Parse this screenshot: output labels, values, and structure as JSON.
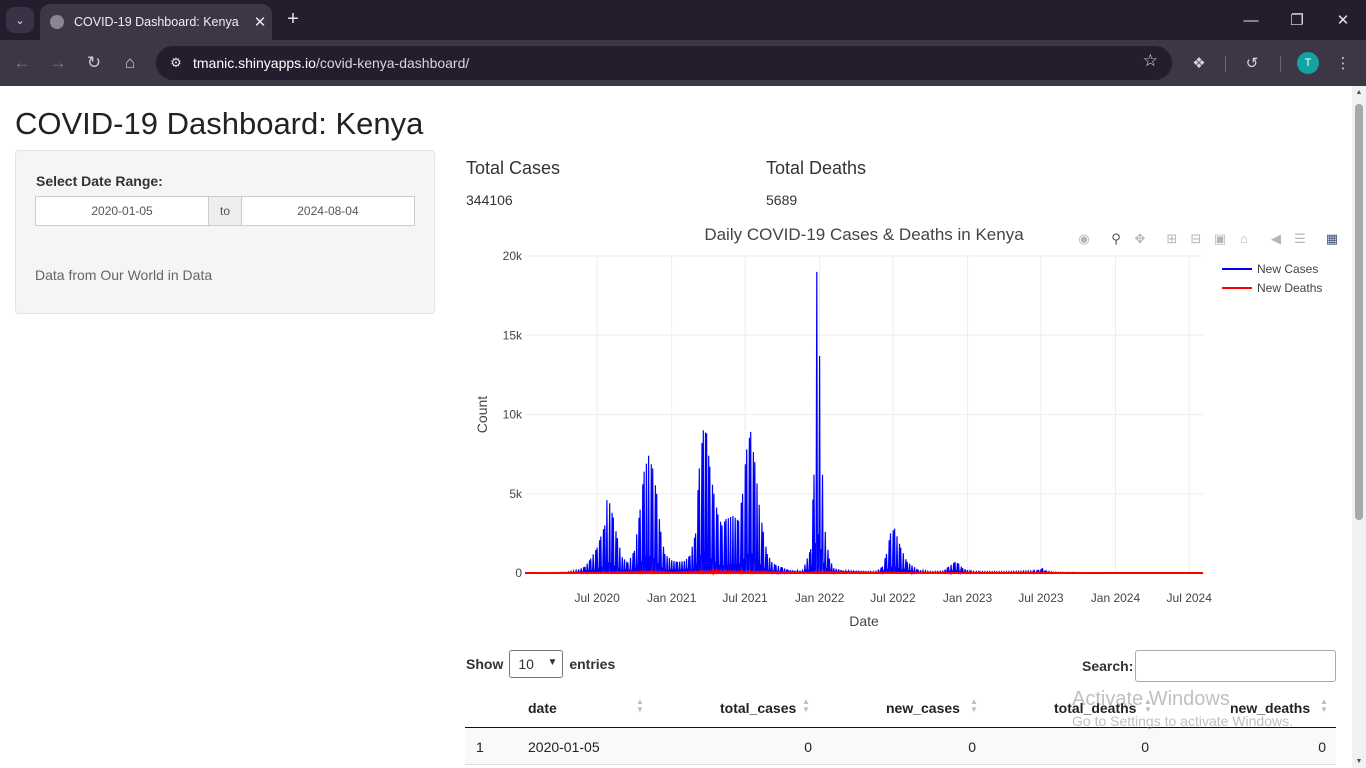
{
  "browser": {
    "tab_title": "COVID-19 Dashboard: Kenya",
    "url_host": "tmanic.shinyapps.io",
    "url_path": "/covid-kenya-dashboard/",
    "profile_initial": "T"
  },
  "page": {
    "title": "COVID-19 Dashboard: Kenya"
  },
  "sidebar": {
    "date_label": "Select Date Range:",
    "start_date": "2020-01-05",
    "range_sep": "to",
    "end_date": "2024-08-04",
    "source_text": "Data from Our World in Data"
  },
  "stats": {
    "cases_label": "Total Cases",
    "cases_value": "344106",
    "deaths_label": "Total Deaths",
    "deaths_value": "5689"
  },
  "chart_data": {
    "type": "line",
    "title": "Daily COVID-19 Cases & Deaths in Kenya",
    "xlabel": "Date",
    "ylabel": "Count",
    "ylim": [
      0,
      20000
    ],
    "yticks": [
      0,
      5000,
      10000,
      15000,
      20000
    ],
    "ytick_labels": [
      "0",
      "5k",
      "10k",
      "15k",
      "20k"
    ],
    "xticks": [
      "2020-07-01",
      "2021-01-01",
      "2021-07-01",
      "2022-01-01",
      "2022-07-01",
      "2023-01-01",
      "2023-07-01",
      "2024-01-01",
      "2024-07-01"
    ],
    "xtick_labels": [
      "Jul 2020",
      "Jan 2021",
      "Jul 2021",
      "Jan 2022",
      "Jul 2022",
      "Jan 2023",
      "Jul 2023",
      "Jan 2024",
      "Jul 2024"
    ],
    "xlim": [
      "2020-01-05",
      "2024-08-04"
    ],
    "legend_position": "top-right",
    "grid": true,
    "series": [
      {
        "name": "New Cases",
        "color": "#0000ff",
        "x": [
          "2020-01-05",
          "2020-03-15",
          "2020-04-15",
          "2020-05-10",
          "2020-06-01",
          "2020-06-15",
          "2020-07-01",
          "2020-07-10",
          "2020-07-20",
          "2020-07-25",
          "2020-08-01",
          "2020-08-10",
          "2020-08-20",
          "2020-09-01",
          "2020-09-15",
          "2020-10-01",
          "2020-10-15",
          "2020-10-25",
          "2020-11-05",
          "2020-11-15",
          "2020-11-25",
          "2020-12-05",
          "2020-12-15",
          "2021-01-01",
          "2021-01-15",
          "2021-02-01",
          "2021-02-15",
          "2021-03-01",
          "2021-03-10",
          "2021-03-20",
          "2021-03-28",
          "2021-04-05",
          "2021-04-15",
          "2021-04-25",
          "2021-05-05",
          "2021-05-15",
          "2021-06-01",
          "2021-06-15",
          "2021-06-25",
          "2021-07-05",
          "2021-07-15",
          "2021-07-25",
          "2021-08-05",
          "2021-08-15",
          "2021-08-25",
          "2021-09-05",
          "2021-09-15",
          "2021-10-01",
          "2021-10-15",
          "2021-11-01",
          "2021-11-20",
          "2021-12-10",
          "2021-12-18",
          "2021-12-25",
          "2022-01-01",
          "2022-01-08",
          "2022-01-15",
          "2022-01-25",
          "2022-02-05",
          "2022-03-01",
          "2022-04-01",
          "2022-05-01",
          "2022-05-20",
          "2022-06-05",
          "2022-06-15",
          "2022-06-25",
          "2022-07-05",
          "2022-07-20",
          "2022-08-05",
          "2022-09-01",
          "2022-10-01",
          "2022-11-01",
          "2022-11-15",
          "2022-12-01",
          "2022-12-10",
          "2022-12-20",
          "2023-01-10",
          "2023-02-01",
          "2023-04-01",
          "2023-06-15",
          "2023-06-25",
          "2023-07-05",
          "2023-07-15",
          "2023-08-01",
          "2023-10-01",
          "2024-01-01",
          "2024-04-01",
          "2024-08-04"
        ],
        "y": [
          0,
          20,
          50,
          150,
          400,
          900,
          1600,
          2300,
          3000,
          4600,
          4400,
          3500,
          2200,
          1000,
          650,
          1400,
          4000,
          6400,
          7400,
          6600,
          5000,
          2600,
          1200,
          800,
          700,
          750,
          1100,
          2500,
          6600,
          9000,
          8800,
          6700,
          5000,
          3700,
          3000,
          3400,
          3600,
          3300,
          5000,
          7800,
          8900,
          7000,
          4300,
          2600,
          1200,
          700,
          500,
          350,
          200,
          150,
          150,
          1500,
          6200,
          19000,
          13700,
          6200,
          2600,
          900,
          300,
          150,
          100,
          80,
          100,
          400,
          1200,
          2500,
          2800,
          1600,
          700,
          200,
          80,
          100,
          400,
          700,
          600,
          300,
          100,
          80,
          80,
          120,
          200,
          300,
          100,
          50,
          30,
          20,
          20,
          20
        ]
      },
      {
        "name": "New Deaths",
        "color": "#ff0000",
        "x": [
          "2020-01-05",
          "2020-07-01",
          "2020-11-15",
          "2021-01-01",
          "2021-04-15",
          "2021-08-01",
          "2021-12-01",
          "2022-01-10",
          "2022-07-01",
          "2023-01-01",
          "2024-08-04"
        ],
        "y": [
          0,
          20,
          80,
          30,
          100,
          70,
          20,
          60,
          20,
          5,
          0
        ]
      }
    ]
  },
  "modebar": {
    "icons": [
      "camera-icon",
      "zoom-icon",
      "pan-icon",
      "zoom-in-icon",
      "zoom-out-icon",
      "autoscale-icon",
      "reset-axes-icon",
      "hover-closest-icon",
      "hover-compare-icon",
      "plotly-logo-icon"
    ]
  },
  "table": {
    "show_label": "Show",
    "entries_label": "entries",
    "page_length": "10",
    "search_label": "Search:",
    "search_value": "",
    "columns": [
      "date",
      "total_cases",
      "new_cases",
      "total_deaths",
      "new_deaths"
    ],
    "rows": [
      {
        "index": "1",
        "date": "2020-01-05",
        "total_cases": "0",
        "new_cases": "0",
        "total_deaths": "0",
        "new_deaths": "0"
      }
    ]
  },
  "watermark": {
    "line1": "Activate Windows",
    "line2": "Go to Settings to activate Windows."
  }
}
